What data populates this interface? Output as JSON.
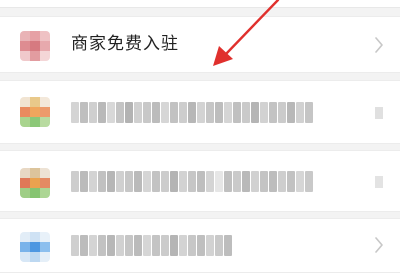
{
  "merchant_entry": {
    "label": "商家免费入驻",
    "icon": "merchant-app-icon",
    "trailing_icon": "chevron-right-icon"
  },
  "colors": {
    "arrow": "#e0302d",
    "chevron": "#c7c7c7",
    "divider": "#ececec",
    "page_bg": "#f3f3f3",
    "row_bg": "#ffffff",
    "label_text": "#222222"
  },
  "annotation": {
    "icon": "red-arrow-icon",
    "target": "merchant_entry"
  }
}
